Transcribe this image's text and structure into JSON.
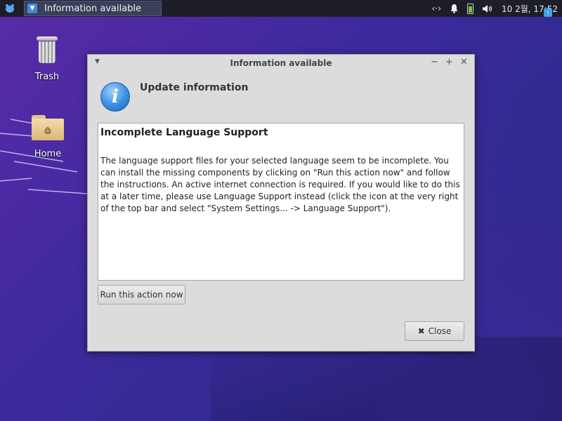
{
  "panel": {
    "task_label": "Information available",
    "clock": "10 2월, 17:52"
  },
  "desktop": {
    "icons": [
      {
        "label": "Trash"
      },
      {
        "label": "Home"
      }
    ]
  },
  "dialog": {
    "title": "Information available",
    "heading": "Update information",
    "content_title": "Incomplete Language Support",
    "content_body": "The language support files for your selected language seem to be incomplete. You can install the missing components by clicking on \"Run this action now\" and follow the instructions. An active internet connection is required. If you would like to do this at a later time, please use Language Support instead (click the icon at the very right of the top bar and select \"System Settings... -> Language Support\").",
    "run_label": "Run this action now",
    "close_label": "Close"
  },
  "colors": {
    "panel_bg": "#1e1e28",
    "dialog_bg": "#dcdcdc",
    "info_blue": "#3a8ee0",
    "battery_green": "#6fc24a"
  }
}
